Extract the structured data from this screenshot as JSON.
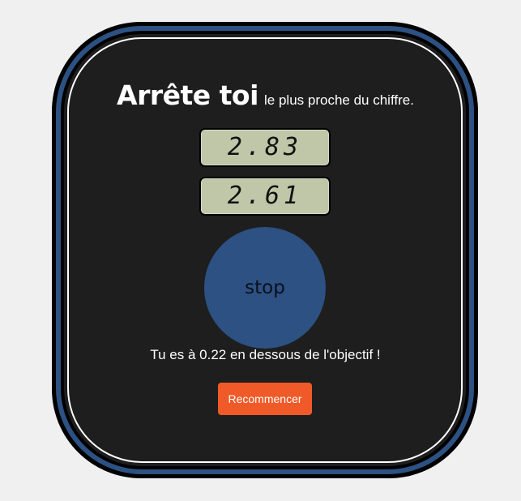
{
  "game": {
    "title_big": "Arrête toi",
    "title_small": "le plus proche du chiffre.",
    "target_value": "2.83",
    "current_value": "2.61",
    "stop_label": "stop",
    "result_message": "Tu es à 0.22 en dessous de l'objectif !",
    "restart_label": "Recommencer"
  },
  "colors": {
    "page_background": "#f0f0f0",
    "device_border": "#000000",
    "device_accent": "#2c5182",
    "panel": "#1e1e1e",
    "lcd": "#bfc7a8",
    "restart_button": "#f05a28"
  }
}
